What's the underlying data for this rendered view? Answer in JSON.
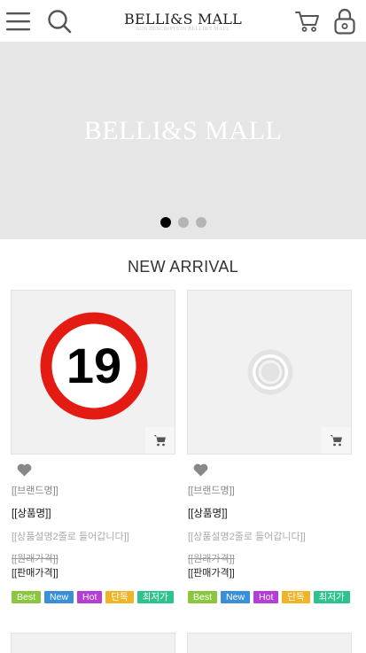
{
  "header": {
    "logo": "BELLI&S MALL",
    "logo_sub": "SUB DESCRIPTION BELLI&S MALL",
    "icons": [
      "menu-icon",
      "search-icon",
      "cart-icon",
      "lock-icon"
    ]
  },
  "banner": {
    "title": "BELLI&S MALL",
    "slides": 3,
    "active_slide": 1
  },
  "section": {
    "title": "NEW ARRIVAL"
  },
  "products": [
    {
      "image": "age-19-restriction-sign",
      "brand": "[[브랜드명]]",
      "name": "[[상품명]]",
      "desc": "[[상품설명2줄로 들어갑니다]]",
      "orig_price": "[[원래가격]]",
      "sale_price": "[[판매가격]]",
      "badges": [
        {
          "label": "Best",
          "color": "#8cc63f"
        },
        {
          "label": "New",
          "color": "#3b8fd9"
        },
        {
          "label": "Hot",
          "color": "#b53fd6"
        },
        {
          "label": "단독",
          "color": "#f0b429"
        },
        {
          "label": "최저가",
          "color": "#2ec28c"
        }
      ]
    },
    {
      "image": "placeholder-image",
      "brand": "[[브랜드명]]",
      "name": "[[상품명]]",
      "desc": "[[상품설명2줄로 들어갑니다]]",
      "orig_price": "[[원래가격]]",
      "sale_price": "[[판매가격]]",
      "badges": [
        {
          "label": "Best",
          "color": "#8cc63f"
        },
        {
          "label": "New",
          "color": "#3b8fd9"
        },
        {
          "label": "Hot",
          "color": "#b53fd6"
        },
        {
          "label": "단독",
          "color": "#f0b429"
        },
        {
          "label": "최저가",
          "color": "#2ec28c"
        }
      ]
    }
  ],
  "age_sign_number": "19"
}
